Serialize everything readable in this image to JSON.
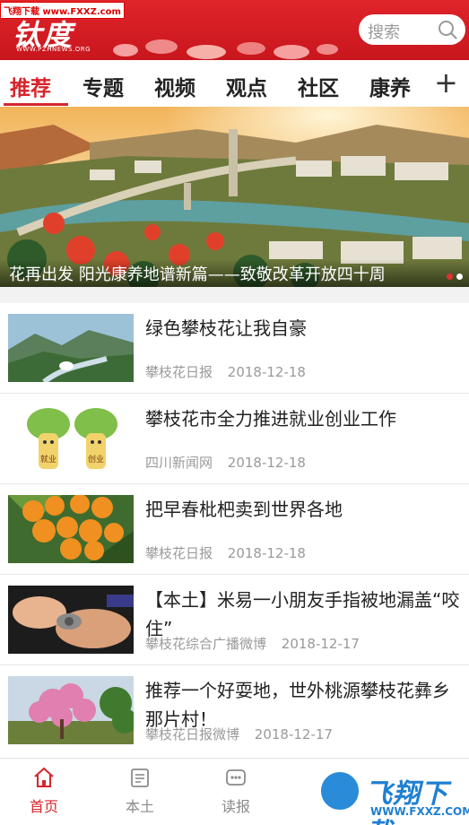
{
  "watermark_top": "飞翔下载 www.FXXZ.com",
  "header": {
    "logo_text": "钛度",
    "logo_url": "WWW.PZHNEWS.ORG",
    "search_placeholder": "搜索"
  },
  "tabs": [
    {
      "label": "推荐",
      "active": true
    },
    {
      "label": "专题",
      "active": false
    },
    {
      "label": "视频",
      "active": false
    },
    {
      "label": "观点",
      "active": false
    },
    {
      "label": "社区",
      "active": false
    },
    {
      "label": "康养",
      "active": false
    }
  ],
  "tab_add_label": "+",
  "banner": {
    "caption": "花再出发 阳光康养地谱新篇——致敬改革开放四十周",
    "dots": 2,
    "active_dot": 0
  },
  "news": [
    {
      "title": "绿色攀枝花让我自豪",
      "source": "攀枝花日报",
      "date": "2018-12-18",
      "thumb": "river-valley"
    },
    {
      "title": "攀枝花市全力推进就业创业工作",
      "source": "四川新闻网",
      "date": "2018-12-18",
      "thumb": "cartoon-trees",
      "thumb_labels": [
        "就业",
        "创业"
      ]
    },
    {
      "title": "把早春枇杷卖到世界各地",
      "source": "攀枝花日报",
      "date": "2018-12-18",
      "thumb": "loquats"
    },
    {
      "title": "【本土】米易一小朋友手指被地漏盖“咬住”",
      "source": "攀枝花综合广播微博",
      "date": "2018-12-17",
      "thumb": "finger"
    },
    {
      "title": "推荐一个好耍地，世外桃源攀枝花彝乡那片村！",
      "source": "攀枝花日报微博",
      "date": "2018-12-17",
      "thumb": "blossom"
    }
  ],
  "bottom_nav": [
    {
      "label": "首页",
      "icon": "home-icon",
      "active": true
    },
    {
      "label": "本土",
      "icon": "local-news-icon",
      "active": false
    },
    {
      "label": "读报",
      "icon": "newspaper-icon",
      "active": false
    }
  ],
  "watermark_bottom": {
    "brand": "飞翔下载",
    "url": "WWW.FXXZ.COM"
  },
  "colors": {
    "brand_red": "#d7252c",
    "header_red": "#c8161d",
    "muted": "#9a9a9a"
  }
}
